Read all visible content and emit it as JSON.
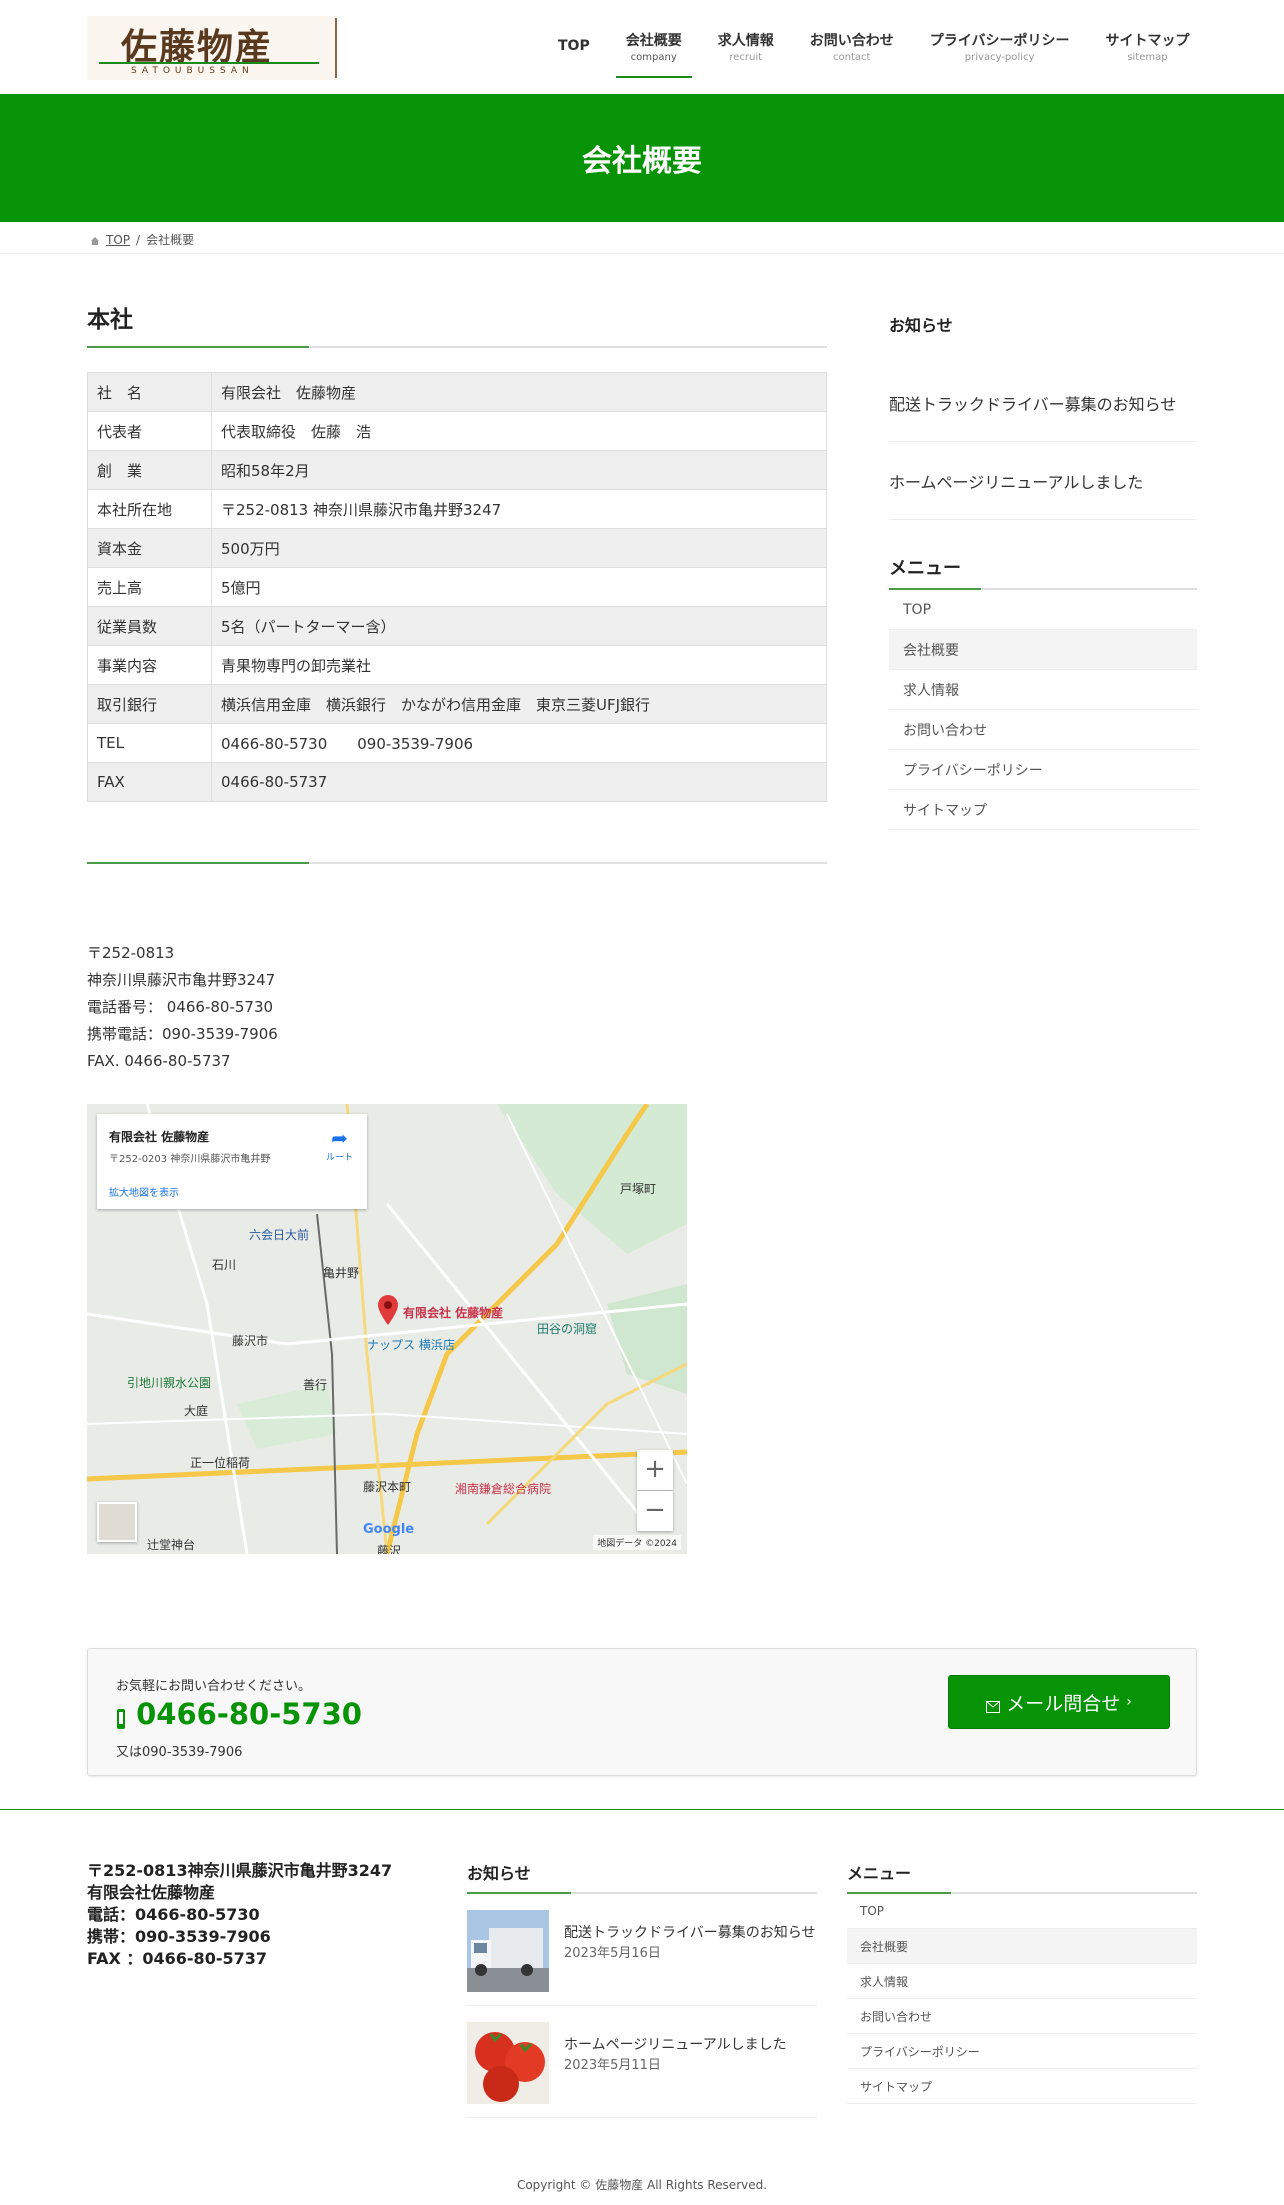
{
  "header": {
    "logo": {
      "text": "佐藤物産",
      "sub": "SATOUBUSSAN"
    },
    "nav": [
      {
        "label": "TOP",
        "sub": ""
      },
      {
        "label": "会社概要",
        "sub": "company"
      },
      {
        "label": "求人情報",
        "sub": "recruit"
      },
      {
        "label": "お問い合わせ",
        "sub": "contact"
      },
      {
        "label": "プライバシーポリシー",
        "sub": "privacy-policy"
      },
      {
        "label": "サイトマップ",
        "sub": "sitemap"
      }
    ]
  },
  "hero": {
    "title": "会社概要"
  },
  "breadcrumb": {
    "home": "TOP",
    "separator": "/",
    "current": "会社概要"
  },
  "main": {
    "section_title": "本社",
    "table": [
      {
        "k": "社　名",
        "v": "有限会社　佐藤物産"
      },
      {
        "k": "代表者",
        "v": "代表取締役　佐藤　浩"
      },
      {
        "k": "創　業",
        "v": "昭和58年2月"
      },
      {
        "k": "本社所在地",
        "v": "〒252-0813 神奈川県藤沢市亀井野3247"
      },
      {
        "k": "資本金",
        "v": "500万円"
      },
      {
        "k": "売上高",
        "v": "5億円"
      },
      {
        "k": "従業員数",
        "v": "5名（パートターマー含）"
      },
      {
        "k": "事業内容",
        "v": "青果物専門の卸売業社"
      },
      {
        "k": "取引銀行",
        "v": "横浜信用金庫　横浜銀行　かながわ信用金庫　東京三菱UFJ銀行"
      },
      {
        "k": "TEL",
        "v": "0466-80-5730　　090-3539-7906"
      },
      {
        "k": "FAX",
        "v": "0466-80-5737"
      }
    ],
    "address_lines": [
      "〒252-0813",
      "神奈川県藤沢市亀井野3247",
      "電話番号： 0466-80-5730",
      "携帯電話：090-3539-7906",
      "FAX. 0466-80-5737"
    ]
  },
  "map": {
    "card_name": "有限会社 佐藤物産",
    "card_address": "〒252-0203 神奈川県藤沢市亀井野",
    "larger_map": "拡大地図を表示",
    "directions": "ルート",
    "pin_label": "有限会社 佐藤物産",
    "places": [
      "六会日大前",
      "亀井野",
      "藤沢市",
      "石川",
      "引地川親水公園",
      "大庭",
      "善行",
      "ナップス 横浜店",
      "田谷の洞窟",
      "湘南鎌倉総合病院",
      "戸塚町",
      "正一位稲荷",
      "藤沢本町",
      "辻堂神台",
      "藤沢"
    ],
    "zoom_in": "+",
    "zoom_out": "−",
    "google": "Google",
    "footer": "地図データ ©2024"
  },
  "sidebar": {
    "news_heading": "お知らせ",
    "news": [
      "配送トラックドライバー募集のお知らせ",
      "ホームページリニューアルしました"
    ],
    "menu_heading": "メニュー",
    "menu": [
      "TOP",
      "会社概要",
      "求人情報",
      "お問い合わせ",
      "プライバシーポリシー",
      "サイトマップ"
    ]
  },
  "contact": {
    "lead": "お気軽にお問い合わせください。",
    "phone_icon": "phone-icon",
    "tel": "0466-80-5730",
    "tel2": "又は090-3539-7906",
    "mail_button": "メール問合せ",
    "mail_icon": "envelope-icon"
  },
  "footer": {
    "address_lines": [
      "〒252-0813神奈川県藤沢市亀井野3247",
      "有限会社佐藤物産",
      "電話：0466-80-5730",
      "携帯：090-3539-7906",
      "FAX ：0466-80-5737"
    ],
    "news_heading": "お知らせ",
    "news": [
      {
        "title": "配送トラックドライバー募集のお知らせ",
        "date": "2023年5月16日"
      },
      {
        "title": "ホームページリニューアルしました",
        "date": "2023年5月11日"
      }
    ],
    "menu_heading": "メニュー",
    "menu": [
      "TOP",
      "会社概要",
      "求人情報",
      "お問い合わせ",
      "プライバシーポリシー",
      "サイトマップ"
    ],
    "copyright": "Copyright © 佐藤物産 All Rights Reserved."
  },
  "colors": {
    "brand_green": "#069406",
    "logo_brown": "#5a3a1e",
    "accent_line": "#4a9a4a"
  }
}
